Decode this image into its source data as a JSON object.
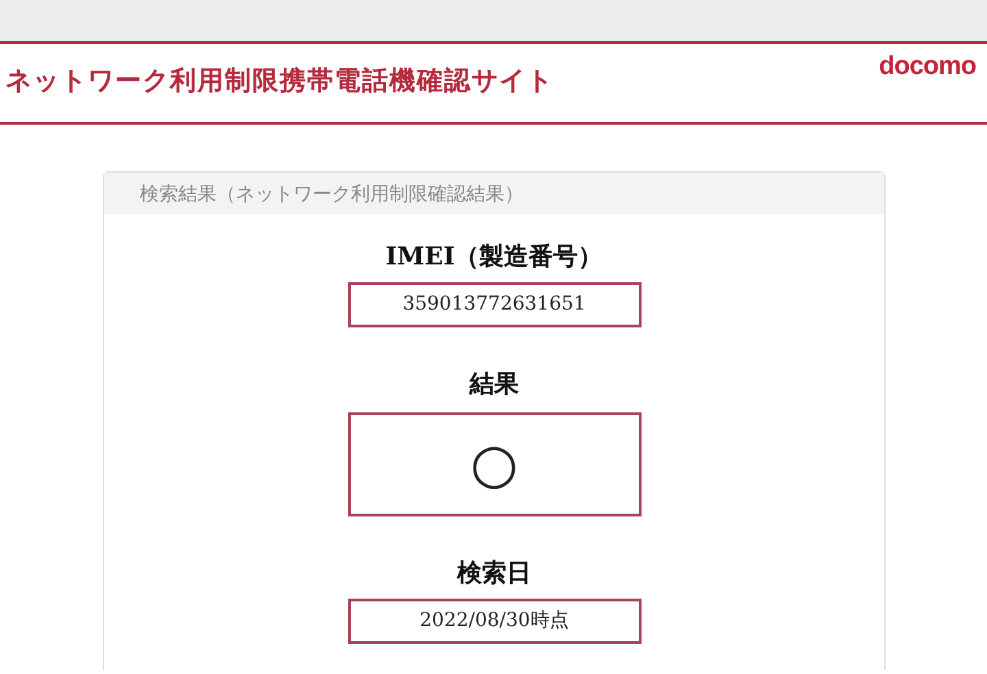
{
  "header": {
    "title": "ネットワーク利用制限携帯電話機確認サイト",
    "logo": "docomo"
  },
  "card": {
    "heading": "検索結果（ネットワーク利用制限確認結果）",
    "fields": [
      {
        "kind": "text",
        "label": "IMEI（製造番号）",
        "value": "359013772631651"
      },
      {
        "kind": "mark",
        "label": "結果",
        "value": "○"
      },
      {
        "kind": "text",
        "label": "検索日",
        "value": "2022/08/30時点"
      }
    ]
  }
}
